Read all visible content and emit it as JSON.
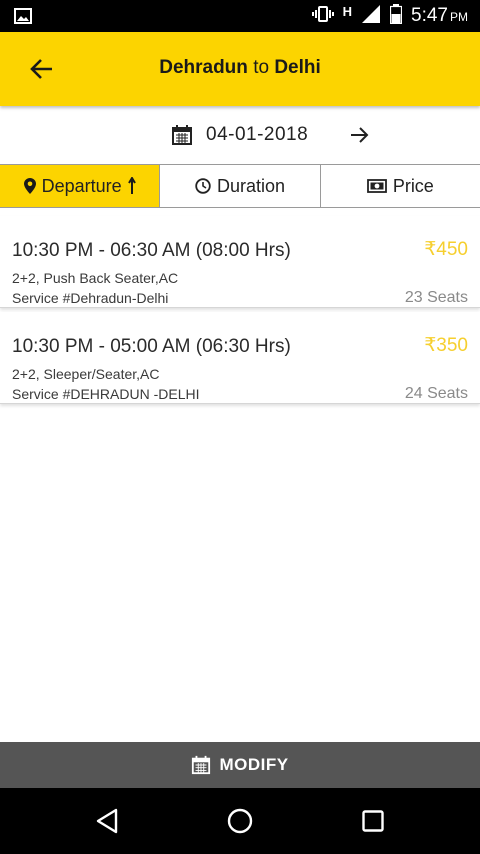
{
  "status_bar": {
    "time": "5:47",
    "ampm": "PM",
    "network": "H",
    "icons": [
      "image-icon",
      "vibrate-icon",
      "signal-icon",
      "battery-icon"
    ]
  },
  "header": {
    "from": "Dehradun",
    "connector": "to",
    "to": "Delhi",
    "back_icon": "arrow-left-icon"
  },
  "date_row": {
    "date": "04-01-2018",
    "calendar_icon": "calendar-icon",
    "next_icon": "arrow-right-icon"
  },
  "sort_tabs": [
    {
      "label": "Departure",
      "icon": "location-pin-icon",
      "active": true,
      "sort_icon": "arrow-up-icon"
    },
    {
      "label": "Duration",
      "icon": "clock-icon",
      "active": false
    },
    {
      "label": "Price",
      "icon": "banknote-icon",
      "active": false
    }
  ],
  "buses": [
    {
      "depart": "10:30 PM",
      "separator": "-",
      "arrive": "06:30 AM",
      "duration": "(08:00 Hrs)",
      "price": "₹450",
      "type": "2+2, Push Back Seater,AC",
      "service": "Service #Dehradun-Delhi",
      "seats": "23 Seats"
    },
    {
      "depart": "10:30 PM",
      "separator": "-",
      "arrive": "05:00 AM",
      "duration": "(06:30 Hrs)",
      "price": "₹350",
      "type": "2+2, Sleeper/Seater,AC",
      "service": "Service #DEHRADUN -DELHI",
      "seats": "24 Seats"
    }
  ],
  "modify": {
    "label": "MODIFY",
    "icon": "calendar-icon"
  },
  "nav": {
    "back": "nav-back-icon",
    "home": "nav-home-icon",
    "recents": "nav-recents-icon"
  },
  "colors": {
    "accent": "#fcd400",
    "price": "#f6cf2e",
    "modify_bar": "#555555"
  }
}
